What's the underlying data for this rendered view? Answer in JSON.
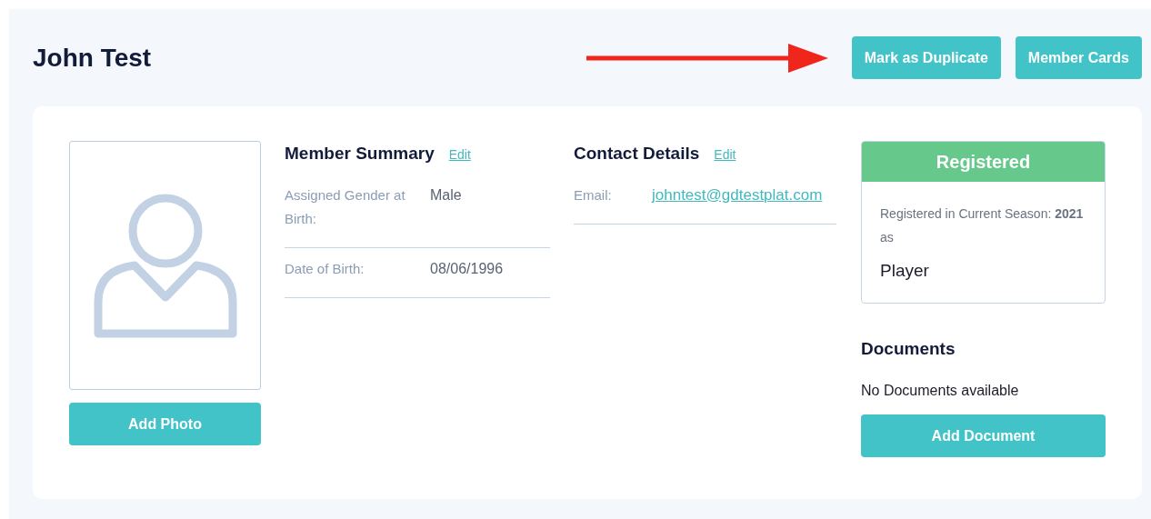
{
  "header": {
    "title": "John Test",
    "buttons": [
      "Mark as Duplicate",
      "Member Cards"
    ]
  },
  "photo": {
    "button": "Add Photo"
  },
  "member_summary": {
    "title": "Member Summary",
    "edit": "Edit",
    "fields": [
      {
        "label": "Assigned Gender at Birth:",
        "value": "Male"
      },
      {
        "label": "Date of Birth:",
        "value": "08/06/1996"
      }
    ]
  },
  "contact_details": {
    "title": "Contact Details",
    "edit": "Edit",
    "fields": [
      {
        "label": "Email:",
        "value": "johntest@gdtestplat.com",
        "kind": "link"
      }
    ]
  },
  "registration": {
    "status": "Registered",
    "text": "Registered in Current Season: **2021** as",
    "role": "Player"
  },
  "documents": {
    "title": "Documents",
    "empty": "No Documents available",
    "button": "Add Document"
  }
}
